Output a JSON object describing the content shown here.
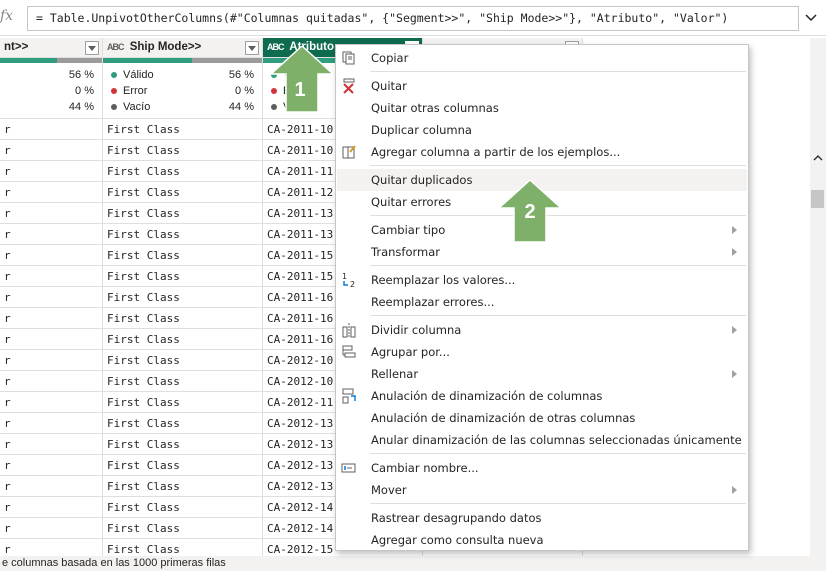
{
  "formula": {
    "fx_label": "fx",
    "expression": "= Table.UnpivotOtherColumns(#\"Columnas quitadas\", {\"Segment>>\", \"Ship Mode>>\"}, \"Atributo\", \"Valor\")"
  },
  "columns": [
    {
      "name": "nt>>",
      "stats": [
        {
          "label": "",
          "pct": "56 %",
          "color": "#2e9e7e"
        },
        {
          "label": "",
          "pct": "0 %",
          "color": "#d13438"
        },
        {
          "label": "",
          "pct": "44 %",
          "color": "#605e5c"
        }
      ],
      "cells": [
        "r",
        "r",
        "r",
        "r",
        "r",
        "r",
        "r",
        "r",
        "r",
        "r",
        "r",
        "r",
        "r",
        "r",
        "r",
        "r",
        "r",
        "r",
        "r",
        "r",
        "r"
      ]
    },
    {
      "name": "Ship Mode>>",
      "type_icon": "ABC",
      "stats": [
        {
          "label": "Válido",
          "pct": "56 %",
          "color": "#2e9e7e"
        },
        {
          "label": "Error",
          "pct": "0 %",
          "color": "#d13438"
        },
        {
          "label": "Vacío",
          "pct": "44 %",
          "color": "#605e5c"
        }
      ],
      "cells": [
        "First Class",
        "First Class",
        "First Class",
        "First Class",
        "First Class",
        "First Class",
        "First Class",
        "First Class",
        "First Class",
        "First Class",
        "First Class",
        "First Class",
        "First Class",
        "First Class",
        "First Class",
        "First Class",
        "First Class",
        "First Class",
        "First Class",
        "First Class",
        "First Class"
      ]
    },
    {
      "name": "Atributo",
      "type_icon": "ABC",
      "stats": [
        {
          "label": "V",
          "pct": "",
          "color": "#2e9e7e"
        },
        {
          "label": "E",
          "pct": "",
          "color": "#d13438"
        },
        {
          "label": "V",
          "pct": "",
          "color": "#605e5c"
        }
      ],
      "cells": [
        "CA-2011-10",
        "CA-2011-10",
        "CA-2011-11",
        "CA-2011-12",
        "CA-2011-13",
        "CA-2011-13",
        "CA-2011-15",
        "CA-2011-15",
        "CA-2011-16",
        "CA-2011-16",
        "CA-2011-16",
        "CA-2012-10",
        "CA-2012-10",
        "CA-2012-11",
        "CA-2012-13",
        "CA-2012-13",
        "CA-2012-13",
        "CA-2012-13",
        "CA-2012-14",
        "CA-2012-14",
        "CA-2012-15"
      ]
    }
  ],
  "status_bar": {
    "text": "e columnas basada en las 1000 primeras filas"
  },
  "context_menu": {
    "items": [
      {
        "label": "Copiar",
        "icon": "copy-icon",
        "submenu": false
      },
      {
        "label": "Quitar",
        "icon": "remove-column-icon",
        "submenu": false
      },
      {
        "label": "Quitar otras columnas",
        "icon": "",
        "submenu": false
      },
      {
        "label": "Duplicar columna",
        "icon": "",
        "submenu": false
      },
      {
        "label": "Agregar columna a partir de los ejemplos...",
        "icon": "column-from-examples-icon",
        "submenu": false
      },
      {
        "label": "Quitar duplicados",
        "icon": "",
        "submenu": false,
        "highlighted": true
      },
      {
        "label": "Quitar errores",
        "icon": "",
        "submenu": false
      },
      {
        "label": "Cambiar tipo",
        "icon": "",
        "submenu": true
      },
      {
        "label": "Transformar",
        "icon": "",
        "submenu": true
      },
      {
        "label": "Reemplazar los valores...",
        "icon": "replace-values-icon",
        "submenu": false
      },
      {
        "label": "Reemplazar errores...",
        "icon": "",
        "submenu": false
      },
      {
        "label": "Dividir columna",
        "icon": "split-column-icon",
        "submenu": true
      },
      {
        "label": "Agrupar por...",
        "icon": "group-by-icon",
        "submenu": false
      },
      {
        "label": "Rellenar",
        "icon": "",
        "submenu": true
      },
      {
        "label": "Anulación de dinamización de columnas",
        "icon": "unpivot-icon",
        "submenu": false
      },
      {
        "label": "Anulación de dinamización de otras columnas",
        "icon": "",
        "submenu": false
      },
      {
        "label": "Anular dinamización de las columnas seleccionadas únicamente",
        "icon": "",
        "submenu": false
      },
      {
        "label": "Cambiar nombre...",
        "icon": "rename-icon",
        "submenu": false
      },
      {
        "label": "Mover",
        "icon": "",
        "submenu": true
      },
      {
        "label": "Rastrear desagrupando datos",
        "icon": "",
        "submenu": false
      },
      {
        "label": "Agregar como consulta nueva",
        "icon": "",
        "submenu": false
      }
    ]
  },
  "callouts": [
    {
      "label": "1"
    },
    {
      "label": "2"
    }
  ],
  "colors": {
    "selected_header": "#0e6b4f",
    "valid": "#2e9e7e",
    "error": "#d13438",
    "empty": "#605e5c",
    "callout": "#7fb069"
  }
}
